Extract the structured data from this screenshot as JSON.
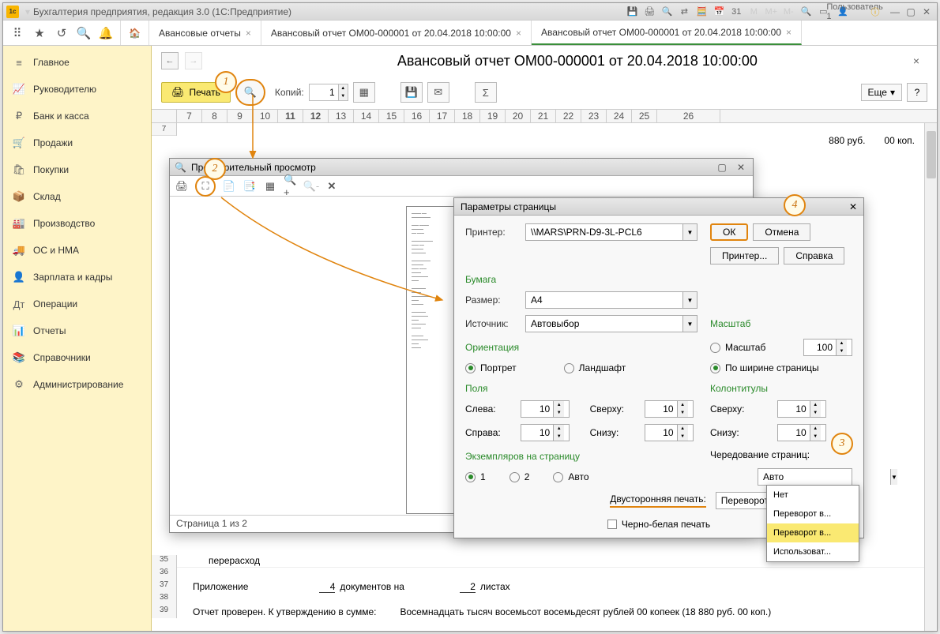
{
  "titlebar": {
    "app_name": "Бухгалтерия предприятия, редакция 3.0  (1С:Предприятие)",
    "user": "Пользователь 1"
  },
  "tabs": [
    {
      "label": "Авансовые отчеты"
    },
    {
      "label": "Авансовый отчет ОМ00-000001 от 20.04.2018 10:00:00"
    },
    {
      "label": "Авансовый отчет ОМ00-000001 от 20.04.2018 10:00:00",
      "active": true
    }
  ],
  "sidebar": {
    "items": [
      {
        "icon": "≡",
        "label": "Главное"
      },
      {
        "icon": "📈",
        "label": "Руководителю"
      },
      {
        "icon": "₽",
        "label": "Банк и касса"
      },
      {
        "icon": "🛒",
        "label": "Продажи"
      },
      {
        "icon": "🛍",
        "label": "Покупки"
      },
      {
        "icon": "📦",
        "label": "Склад"
      },
      {
        "icon": "🏭",
        "label": "Производство"
      },
      {
        "icon": "🚚",
        "label": "ОС и НМА"
      },
      {
        "icon": "👤",
        "label": "Зарплата и кадры"
      },
      {
        "icon": "Дт",
        "label": "Операции"
      },
      {
        "icon": "📊",
        "label": "Отчеты"
      },
      {
        "icon": "📚",
        "label": "Справочники"
      },
      {
        "icon": "⚙",
        "label": "Администрирование"
      }
    ]
  },
  "doc": {
    "title": "Авансовый отчет ОМ00-000001 от 20.04.2018 10:00:00",
    "print_label": "Печать",
    "copies_label": "Копий:",
    "copies_value": "1",
    "more_label": "Еще",
    "help": "?"
  },
  "ruler_start": 7,
  "ruler_end": 26,
  "sheet_rows": {
    "r7": "7",
    "amount": "880  руб.",
    "kop": "00 коп.",
    "r35": "35",
    "overrun": "перерасход",
    "r36": "36",
    "r37": "37",
    "attachment": "Приложение",
    "docs_count": "4",
    "docs_on": "документов на",
    "sheets_count": "2",
    "sheets": "листах",
    "r38": "38",
    "r39": "39",
    "checked": "Отчет проверен. К утверждению в сумме:",
    "sum_words": "Восемнадцать тысяч восемьсот восемьдесят рублей 00 копеек (18 880 руб. 00 коп.)"
  },
  "preview": {
    "title": "Предварительный просмотр",
    "status": "Страница 1 из 2"
  },
  "params": {
    "title": "Параметры страницы",
    "printer_label": "Принтер:",
    "printer_value": "\\\\MARS\\PRN-D9-3L-PCL6",
    "ok": "ОК",
    "cancel": "Отмена",
    "printer_btn": "Принтер...",
    "help": "Справка",
    "paper_section": "Бумага",
    "size_label": "Размер:",
    "size_value": "A4",
    "source_label": "Источник:",
    "source_value": "Автовыбор",
    "scale_section": "Масштаб",
    "scale_radio": "Масштаб",
    "scale_value": "100",
    "fit_radio": "По ширине страницы",
    "orient_section": "Ориентация",
    "portrait": "Портрет",
    "landscape": "Ландшафт",
    "margins_section": "Поля",
    "footers_section": "Колонтитулы",
    "left": "Слева:",
    "right": "Справа:",
    "top": "Сверху:",
    "bottom": "Снизу:",
    "margin_left": "10",
    "margin_right": "10",
    "margin_top": "10",
    "margin_bottom": "10",
    "footer_top": "10",
    "footer_bottom": "10",
    "copies_section": "Экземпляров на страницу",
    "opt1": "1",
    "opt2": "2",
    "optAuto": "Авто",
    "alternation": "Чередование страниц:",
    "alternation_value": "Авто",
    "duplex": "Двусторонняя печать:",
    "duplex_value": "Переворот влев",
    "bw": "Черно-белая печать"
  },
  "duplex_options": [
    "Нет",
    "Переворот в...",
    "Переворот в...",
    "Использоват..."
  ],
  "steps": {
    "s1": "1",
    "s2": "2",
    "s3": "3",
    "s4": "4"
  }
}
